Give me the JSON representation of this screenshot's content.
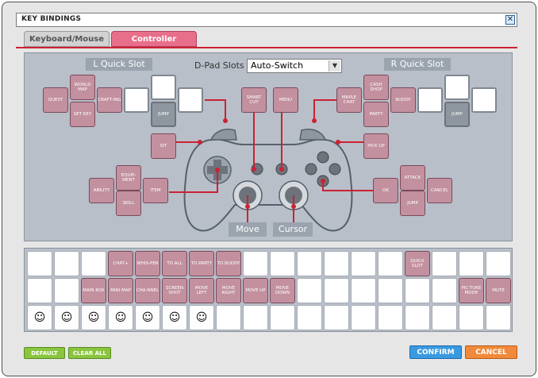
{
  "window": {
    "title": "KEY BINDINGS",
    "close": "✕"
  },
  "tabs": [
    {
      "label": "Keyboard/Mouse"
    },
    {
      "label": "Controller"
    }
  ],
  "upper": {
    "l_quick_slot": "L Quick Slot",
    "r_quick_slot": "R Quick Slot",
    "dpad_label": "D-Pad Slots",
    "dpad_value": "Auto-Switch",
    "move": "Move",
    "cursor": "Cursor"
  },
  "keys": {
    "quest": "Quest",
    "world_map": "World Map",
    "set_key": "Set Key",
    "crafting": "Craft-ing",
    "jump_l": "Jump",
    "smart_cut": "Smart Cut",
    "menu": "Menu",
    "maple_chat": "Maple Chat",
    "cash_shop": "Cash Shop",
    "party": "Party",
    "buddy": "Buddy",
    "jump_r": "Jump",
    "sit": "Sit",
    "pick_up": "Pick Up",
    "ability": "Ability",
    "equipment": "Equip-ment",
    "item": "Item",
    "skill": "Skill",
    "ok": "OK",
    "attack": "Attack",
    "cancel": "Cancel",
    "jump_face": "Jump"
  },
  "lower": {
    "row1": [
      "",
      "",
      "",
      "Chat+",
      "Whis-per",
      "To All",
      "To Party",
      "To Buddy",
      "",
      "",
      "",
      "",
      "",
      "",
      "Quick Slot",
      "",
      "",
      ""
    ],
    "row2": [
      "",
      "",
      "Main Box",
      "Mini Map",
      "Cha-nnel",
      "Screen Shot",
      "Move Left",
      "Move Right",
      "Move Up",
      "Move Down",
      "",
      "",
      "",
      "",
      "",
      "",
      "Pic-ture Mode",
      "Mute"
    ],
    "row3": [
      "☺",
      "☺",
      "☺",
      "☺",
      "☺",
      "☺",
      "☺",
      "",
      "",
      "",
      "",
      "",
      "",
      "",
      "",
      "",
      "",
      ""
    ]
  },
  "footer": {
    "default": "DEFAULT",
    "clear_all": "CLEAR ALL",
    "confirm": "CONFIRM",
    "cancel": "CANCEL"
  },
  "colors": {
    "accent": "#e86f8a",
    "panel": "#b8bfc9",
    "pink_key": "#c2909f",
    "line": "#cc2233"
  }
}
